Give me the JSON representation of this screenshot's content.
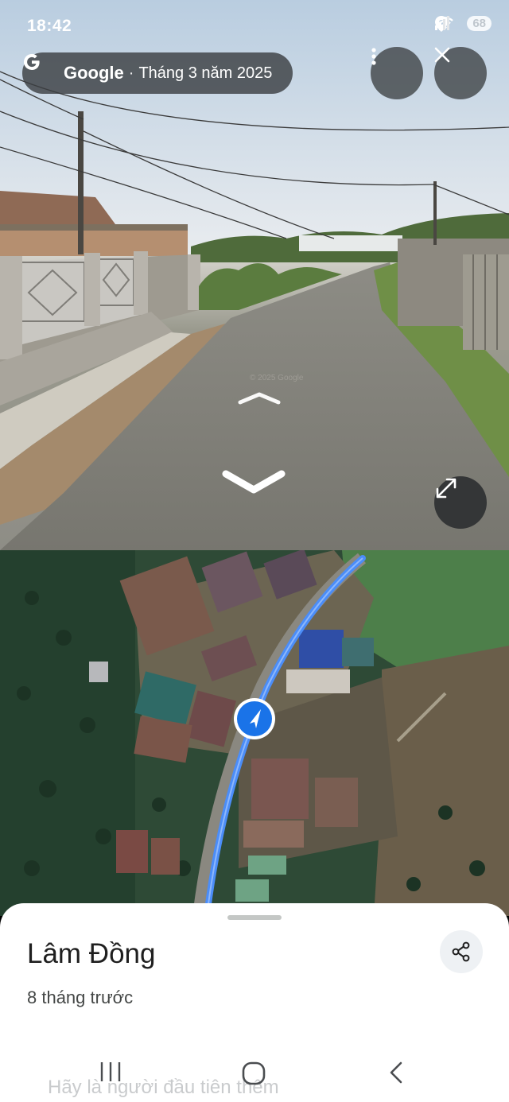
{
  "status_bar": {
    "time": "18:42",
    "battery": "68",
    "icons": [
      "location-icon",
      "wifi-icon",
      "signal-icon",
      "signal-icon",
      "battery-icon"
    ]
  },
  "header": {
    "brand": "Google",
    "separator": "·",
    "capture_date": "Tháng 3 năm 2025",
    "more_icon": "more-vertical-icon",
    "close_icon": "close-icon"
  },
  "street_view": {
    "watermark": "© 2025 Google",
    "forward_icon": "chevron-up-icon",
    "back_icon": "chevron-down-icon",
    "expand_icon": "expand-icon"
  },
  "map": {
    "position_marker_icon": "navigation-arrow-icon",
    "route_color": "#4b8df8"
  },
  "place": {
    "title": "Lâm Đồng",
    "subtitle": "8 tháng trước",
    "share_icon": "share-icon",
    "partial_text": "Hãy là người đầu tiên thêm"
  },
  "system_nav": {
    "recents_icon": "recents-icon",
    "home_icon": "home-icon",
    "back_icon": "back-icon"
  },
  "colors": {
    "pill_bg": "#3c4043",
    "marker_blue": "#1a73e8",
    "sheet_bg": "#ffffff"
  }
}
